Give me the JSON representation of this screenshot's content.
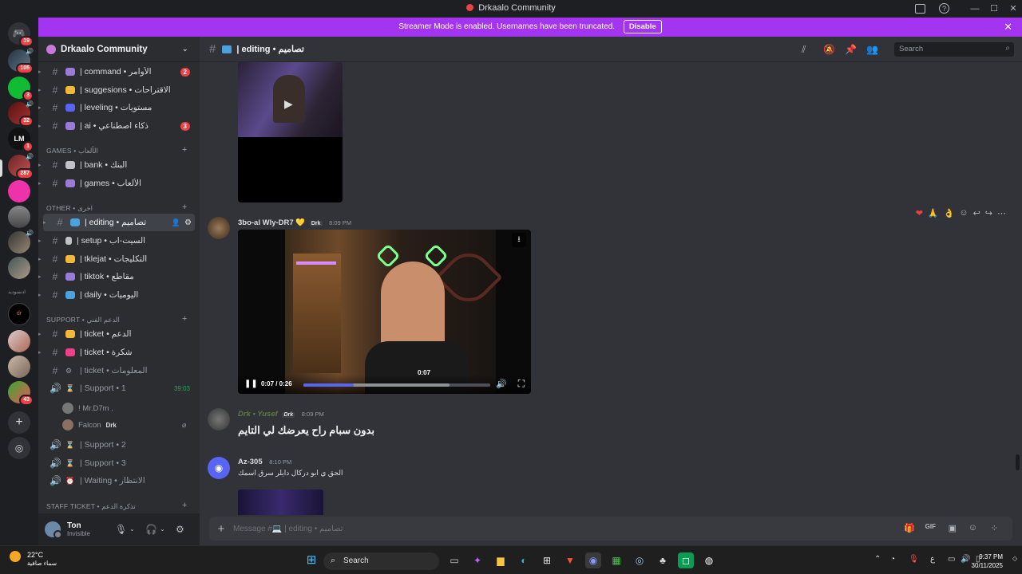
{
  "window": {
    "title": "Drkaalo Community"
  },
  "banner": {
    "text": "Streamer Mode is enabled. Usernames have been truncated.",
    "disable_label": "Disable"
  },
  "servers": [
    {
      "badge": "19"
    },
    {
      "badge": "105"
    },
    {
      "badge": "3"
    },
    {
      "badge": "32"
    },
    {
      "label": "LM",
      "badge": "1"
    },
    {
      "badge": "287"
    },
    {},
    {},
    {},
    {},
    {
      "label": "dr"
    },
    {
      "label": "ادنسوديد"
    },
    {},
    {},
    {},
    {
      "badge": "43"
    }
  ],
  "sidebar": {
    "server_name": "Drkaalo Community",
    "channels_top": [
      {
        "name": "| command • الأوامر",
        "badge": "2"
      },
      {
        "name": "| suggesions • الاقتراحات"
      },
      {
        "name": "| leveling • مستويات"
      },
      {
        "name": "| ai • ذكاء اصطناعي",
        "badge": "3"
      }
    ],
    "cat_games": "GAMES • الألعاب",
    "channels_games": [
      {
        "name": "| bank • البنك"
      },
      {
        "name": "| games • الألعاب"
      }
    ],
    "cat_other": "OTHER • اخرى",
    "channels_other": [
      {
        "name": "| editing • تصاميم"
      },
      {
        "name": "| setup • السيت-اب"
      },
      {
        "name": "| tklejat • التكليجات"
      },
      {
        "name": "| tiktok • مقاطع"
      },
      {
        "name": "| daily • اليوميات"
      }
    ],
    "cat_support": "SUPPORT • الدعم الفني",
    "channels_support": [
      {
        "name": "| ticket • الدعم"
      },
      {
        "name": "| ticket • شكرة"
      },
      {
        "name": "| ticket • المعلومات"
      }
    ],
    "voice_support1": {
      "name": "| Support • 1",
      "time": "39:03"
    },
    "voice_users": [
      {
        "name": "! Mr.D7m ."
      },
      {
        "name": "Falcon",
        "tag": "Drk"
      }
    ],
    "voice_support2": "| Support • 2",
    "voice_support3": "| Support • 3",
    "voice_waiting": "| Waiting • الانتظار",
    "cat_staff": "STAFF TICKET • تذكرة الدعم",
    "user": {
      "name": "Ton",
      "status": "Invisible"
    }
  },
  "channel": {
    "name": "| editing • تصاميم",
    "search_placeholder": "Search"
  },
  "messages": [
    {
      "author": "3bo-al Wly-DR7",
      "tag": "Drk",
      "time": "8:09 PM",
      "video": {
        "current": "0:07",
        "duration": "0:26",
        "time_label": "0:07 / 0:26",
        "progress": 0.27
      }
    },
    {
      "author": "Drk • Yusef",
      "tag": "Drk",
      "time": "8:09 PM",
      "text": "بدون سبام راح يعرضك لي التايم"
    },
    {
      "author": "Az-305",
      "time": "8:10 PM",
      "text": "الحق ي ابو دركال دايلر سرق اسمك"
    }
  ],
  "composer": {
    "placeholder": "Message #💻 | editing • تصاميم"
  },
  "taskbar": {
    "temp": "22°C",
    "weather_text": "سماء صافية",
    "search": "Search",
    "lang": "ع",
    "time": "9:37 PM",
    "date": "30/11/2025"
  },
  "colors": {
    "banner": "#a335f1",
    "accent": "#5865f2",
    "mention": "#f23f43"
  }
}
